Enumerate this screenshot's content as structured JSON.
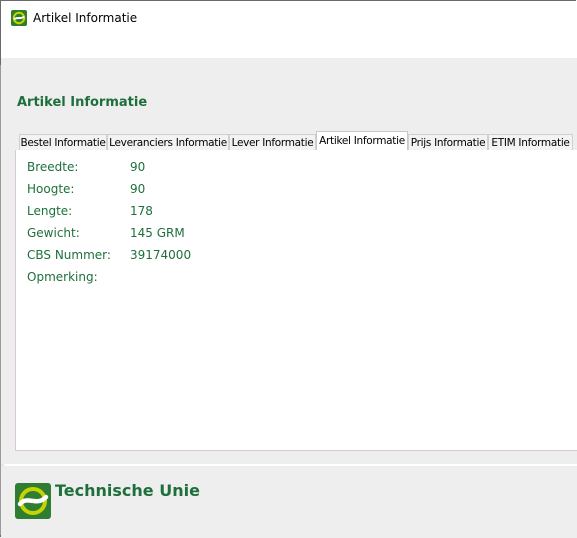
{
  "window": {
    "title": "Artikel Informatie",
    "app_icon": "technische-unie-logo-icon"
  },
  "section": {
    "title": "Artikel Informatie"
  },
  "tabs": [
    {
      "label": "Bestel Informatie",
      "active": false
    },
    {
      "label": "Leveranciers Informatie",
      "active": false
    },
    {
      "label": "Lever Informatie",
      "active": false
    },
    {
      "label": "Artikel Informatie",
      "active": true
    },
    {
      "label": "Prijs Informatie",
      "active": false
    },
    {
      "label": "ETIM Informatie",
      "active": false
    }
  ],
  "fields": [
    {
      "label": "Breedte:",
      "value": "90"
    },
    {
      "label": "Hoogte:",
      "value": "90"
    },
    {
      "label": "Lengte:",
      "value": "178"
    },
    {
      "label": "Gewicht:",
      "value": "145 GRM"
    },
    {
      "label": "CBS Nummer:",
      "value": "39174000"
    },
    {
      "label": "Opmerking:",
      "value": ""
    }
  ],
  "footer": {
    "brand": "Technische Unie"
  },
  "colors": {
    "accent_green": "#1e6f3c",
    "logo_green": "#2e7d32",
    "logo_yellow": "#c6d400"
  }
}
